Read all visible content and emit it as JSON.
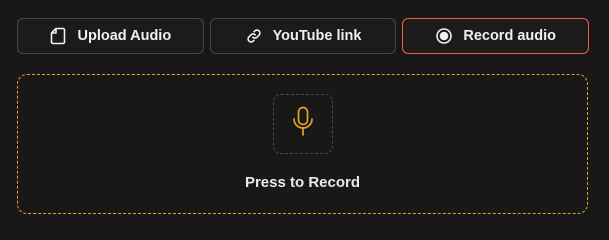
{
  "source_tabs": [
    {
      "label": "Upload Audio",
      "icon": "file-icon",
      "active": false
    },
    {
      "label": "YouTube link",
      "icon": "link-icon",
      "active": false
    },
    {
      "label": "Record audio",
      "icon": "record-icon",
      "active": true
    }
  ],
  "record_area": {
    "prompt": "Press to Record",
    "icon": "microphone-icon"
  },
  "colors": {
    "active_tab_border": "#e8623d",
    "dropzone_border": "#e6a024",
    "mic_icon": "#e6a024",
    "background": "#181818"
  }
}
